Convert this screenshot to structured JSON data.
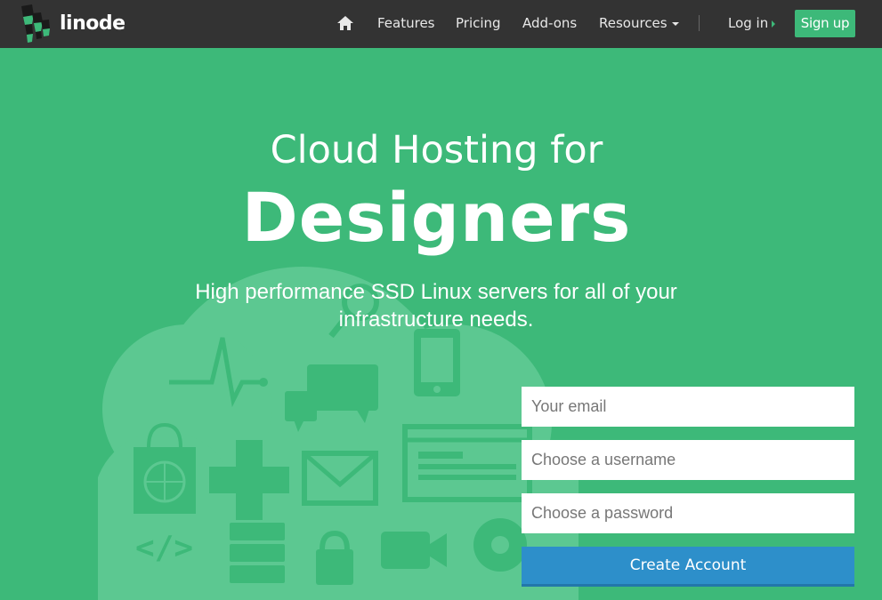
{
  "brand": {
    "name": "linode",
    "color": "#3db979"
  },
  "nav": {
    "home_icon": "home-icon",
    "features": "Features",
    "pricing": "Pricing",
    "addons": "Add-ons",
    "resources": "Resources",
    "login": "Log in",
    "signup": "Sign up"
  },
  "hero": {
    "title_line1": "Cloud Hosting for",
    "title_line2": "Designers",
    "subtitle": "High performance SSD Linux servers for all of your infrastructure needs."
  },
  "form": {
    "email_placeholder": "Your email",
    "username_placeholder": "Choose a username",
    "password_placeholder": "Choose a password",
    "submit_label": "Create Account"
  },
  "colors": {
    "nav_bg": "#333333",
    "hero_bg": "#3db979",
    "button_blue": "#2d8fca"
  }
}
